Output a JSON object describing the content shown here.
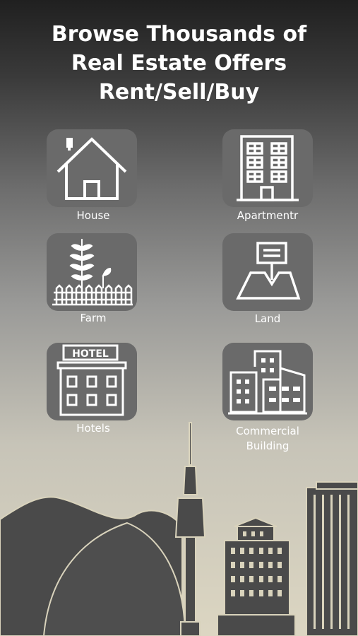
{
  "header": {
    "title_line1": "Browse Thousands of",
    "title_line2": "Real Estate Offers",
    "title_line3": "Rent/Sell/Buy"
  },
  "categories": [
    {
      "label": "House",
      "icon": "house-icon"
    },
    {
      "label": "Apartmentr",
      "icon": "apartment-building-icon"
    },
    {
      "label": "Farm",
      "icon": "farm-plant-fence-icon"
    },
    {
      "label": "Land",
      "icon": "land-plot-sign-icon"
    },
    {
      "label": "Hotels",
      "icon": "hotel-building-icon",
      "sign_text": "HOTEL"
    },
    {
      "label_line1": "Commercial",
      "label_line2": "Building",
      "icon": "commercial-buildings-icon"
    }
  ],
  "colors": {
    "tile_bg": "#6a6a6a",
    "skyline": "#4a4a4a",
    "skyline_outline": "#d9d3bc",
    "text": "#ffffff"
  }
}
